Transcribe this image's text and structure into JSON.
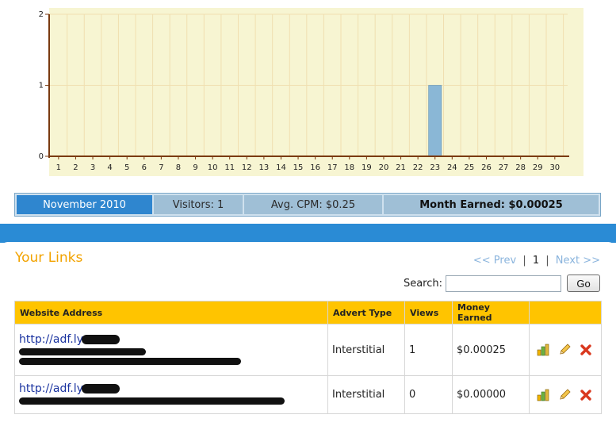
{
  "chart_data": {
    "type": "bar",
    "categories": [
      "1",
      "2",
      "3",
      "4",
      "5",
      "6",
      "7",
      "8",
      "9",
      "10",
      "11",
      "12",
      "13",
      "14",
      "15",
      "16",
      "17",
      "18",
      "19",
      "20",
      "21",
      "22",
      "23",
      "24",
      "25",
      "26",
      "27",
      "28",
      "29",
      "30"
    ],
    "values": [
      0,
      0,
      0,
      0,
      0,
      0,
      0,
      0,
      0,
      0,
      0,
      0,
      0,
      0,
      0,
      0,
      0,
      0,
      0,
      0,
      0,
      0,
      1,
      0,
      0,
      0,
      0,
      0,
      0,
      0
    ],
    "ylim": [
      0,
      2
    ],
    "yticks": [
      "0",
      "1",
      "2"
    ],
    "grid": true,
    "colors": {
      "background": "#f7f5d2",
      "grid": "#f0dfb0",
      "axis": "#7a3a10",
      "bar": "#8ab7d6",
      "bar_stroke": "#5f92b8"
    }
  },
  "stats": {
    "month": "November 2010",
    "visitors": "Visitors: 1",
    "avg_cpm": "Avg. CPM: $0.25",
    "month_earned": "Month Earned: $0.00025"
  },
  "links": {
    "title": "Your Links",
    "pager": {
      "prev": "<< Prev",
      "current": "1",
      "next": "Next >>",
      "separator": "|"
    },
    "search": {
      "label": "Search:",
      "placeholder": "",
      "value": "",
      "button": "Go"
    },
    "columns": [
      "Website Address",
      "Advert Type",
      "Views",
      "Money Earned",
      ""
    ],
    "rows": [
      {
        "url": "http://adf.ly",
        "advert_type": "Interstitial",
        "views": "1",
        "money_earned": "$0.00025"
      },
      {
        "url": "http://adf.ly",
        "advert_type": "Interstitial",
        "views": "0",
        "money_earned": "$0.00000"
      }
    ],
    "action_icons": [
      "stats-icon",
      "edit-icon",
      "delete-icon"
    ]
  },
  "colors": {
    "accent_blue": "#2a8bd5",
    "title_orange": "#f2a300",
    "header_yellow": "#ffc400"
  }
}
